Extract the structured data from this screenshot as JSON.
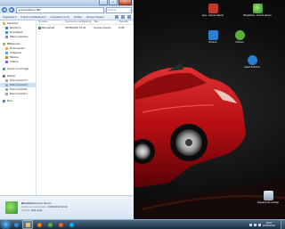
{
  "window": {
    "title": "",
    "controls": {
      "minimize": "–",
      "maximize": "□",
      "close": "✕"
    },
    "address": "▸ Respaldos ▸ Bkn",
    "search_placeholder": "Buscar",
    "toolbar": [
      "Organizar ▾",
      "Incluir en biblioteca ▾",
      "Compartir con ▾",
      "Grabar",
      "Nueva carpeta"
    ],
    "nav": [
      {
        "label": "Favoritos",
        "icon": "star-icon",
        "level": 0
      },
      {
        "label": "Escritorio",
        "icon": "desktop-icon",
        "level": 1
      },
      {
        "label": "Descargas",
        "icon": "download-icon",
        "level": 1
      },
      {
        "label": "Sitios recientes",
        "icon": "recent-icon",
        "level": 1
      },
      {
        "label": "Bibliotecas",
        "icon": "library-icon",
        "level": 0
      },
      {
        "label": "Documentos",
        "icon": "documents-icon",
        "level": 1
      },
      {
        "label": "Imágenes",
        "icon": "pictures-icon",
        "level": 1
      },
      {
        "label": "Música",
        "icon": "music-icon",
        "level": 1
      },
      {
        "label": "Vídeos",
        "icon": "video-icon",
        "level": 1
      },
      {
        "label": "Grupo en el hogar",
        "icon": "homegroup-icon",
        "level": 0
      },
      {
        "label": "Equipo",
        "icon": "computer-icon",
        "level": 0
      },
      {
        "label": "Disco local (C:)",
        "icon": "drive-icon",
        "level": 1
      },
      {
        "label": "Disco local (D:)",
        "icon": "drive-icon",
        "level": 1
      },
      {
        "label": "Disco local (E:)",
        "icon": "drive-icon",
        "level": 1
      },
      {
        "label": "Disco local (F:)",
        "icon": "drive-icon",
        "level": 1
      },
      {
        "label": "Red",
        "icon": "network-icon",
        "level": 0
      }
    ],
    "columns": [
      "Nombre",
      "Fecha de modificación",
      "Tipo",
      "Tamaño"
    ],
    "files": [
      {
        "name": "Bloodshed",
        "date": "23/05/2010 13:40",
        "type": "Acceso directo",
        "size": "2 KB"
      }
    ],
    "details": {
      "name": "Bloodshed",
      "type": "Acceso directo",
      "modified_label": "Fecha de modificación:",
      "modified": "23/05/2010 13:40",
      "size_label": "Tamaño:",
      "size": "862 bytes"
    }
  },
  "desktop_icons": [
    {
      "label": "ares - Acceso directo",
      "icon": "ares-icon",
      "color": "#c0392b"
    },
    {
      "label": "Bloodshed - Acceso directo",
      "icon": "bloodshed-icon",
      "color": "#3aa33a"
    },
    {
      "label": "dropbox",
      "icon": "dropbox-icon",
      "color": "#2f7fd1"
    },
    {
      "label": "uTorrent",
      "icon": "utorrent-icon",
      "color": "#5cae3b"
    },
    {
      "label": "avast! Antivirus",
      "icon": "avast-icon",
      "color": "#2a7fd0"
    },
    {
      "label": "Papelera de reciclaje",
      "icon": "recycle-bin-icon",
      "color": "#9fb4c9"
    }
  ],
  "taskbar": {
    "apps": [
      {
        "name": "internet-explorer-icon",
        "color": "#3b8ad9"
      },
      {
        "name": "explorer-folder-icon",
        "color": "#e7c25a"
      },
      {
        "name": "media-player-icon",
        "color": "#e67e22"
      },
      {
        "name": "chrome-icon",
        "color": "#4caf50"
      },
      {
        "name": "firefox-icon",
        "color": "#e8612c"
      },
      {
        "name": "skype-icon",
        "color": "#00aff0"
      }
    ],
    "clock_time": "18:07",
    "clock_date": "23/05/2010"
  }
}
